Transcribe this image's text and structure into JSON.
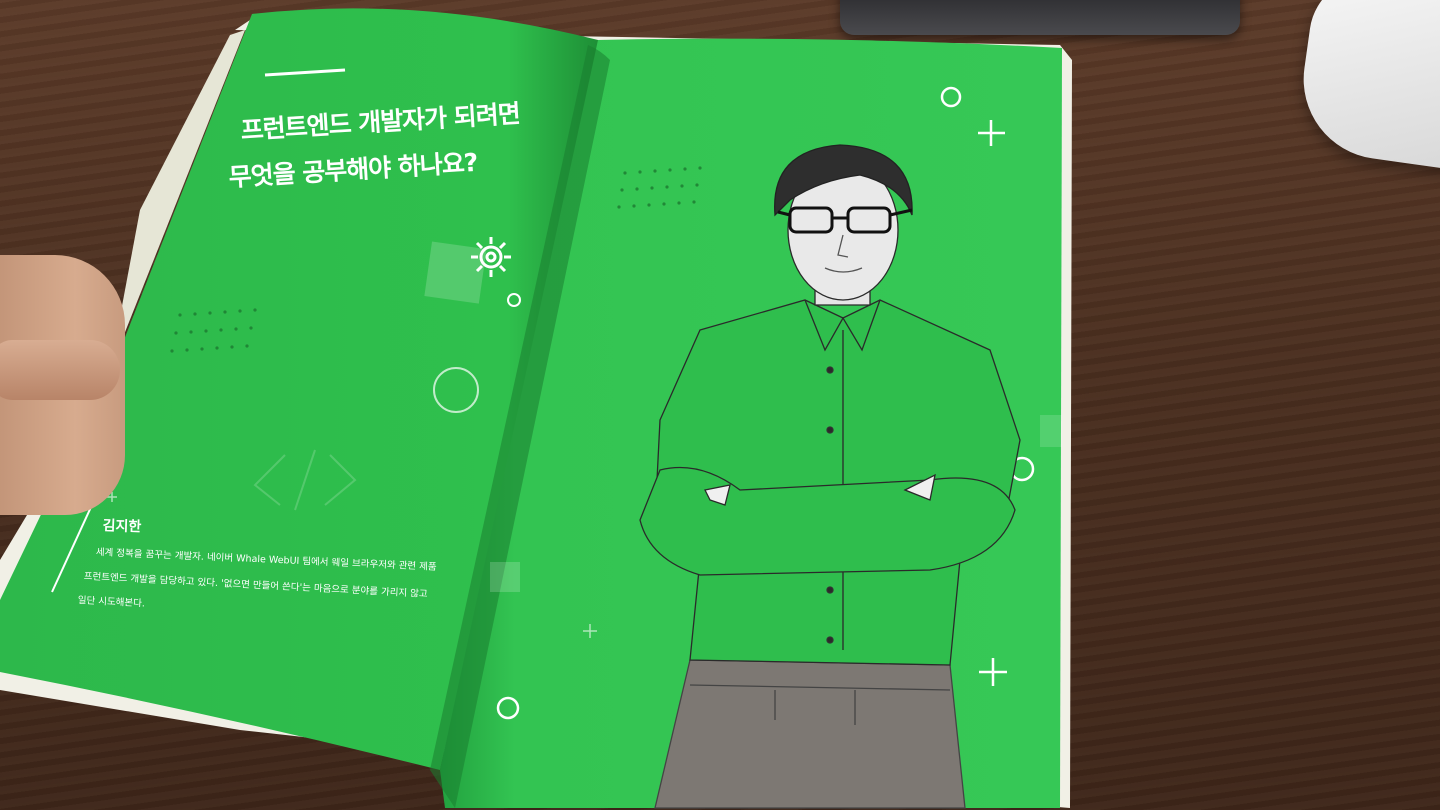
{
  "book": {
    "headline_line1": "프런트엔드 개발자가 되려면",
    "headline_line2": "무엇을 공부해야 하나요?",
    "author_name": "김지한",
    "bio_line1": "세계 정복을 꿈꾸는 개발자. 네이버 Whale WebUI 팀에서 웨일 브라우저와 관련 제품",
    "bio_line2": "프런트엔드 개발을 담당하고 있다. '없으면 만들어 쓴다'는 마음으로 분야를 가리지 않고",
    "bio_line3": "일단 시도해본다.",
    "page_color": "#2fbf4c"
  },
  "scene": {
    "illustration": "portrait of a man with glasses and crossed arms",
    "icons": [
      "gear-icon",
      "circle-icon",
      "plus-icon",
      "code-brackets-icon"
    ]
  }
}
